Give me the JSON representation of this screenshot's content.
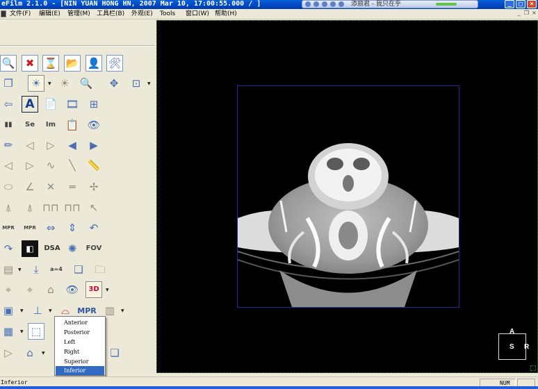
{
  "window": {
    "title": "eFilm 2.1.0 - [NIN YUAN HONG HN, 2007 Mar 10, 17:00:55.000 / ]",
    "media_text": "添丽君 - 我只在乎",
    "controls": {
      "minimize": "_",
      "maximize": "□",
      "close": "×"
    }
  },
  "menubar": {
    "items": [
      "文件(F)",
      "编辑(E)",
      "管理(M)",
      "工具栏(B)",
      "外观(E)",
      "Tools",
      "窗口(W)",
      "帮助(H)"
    ],
    "mdi_controls": {
      "minimize": "_",
      "restore": "❐",
      "close": "×"
    }
  },
  "toolbox": {
    "labels": {
      "dsa": "DSA",
      "fov": "FOV",
      "mpr": "MPR",
      "mpr_small": "MPR",
      "se": "Se",
      "im": "Im",
      "text_tool": "A",
      "dim": "3D"
    }
  },
  "dropdown": {
    "options": [
      "Anterior",
      "Posterior",
      "Left",
      "Right",
      "Superior",
      "Inferior"
    ],
    "selected": "Inferior"
  },
  "viewport": {
    "orientation": {
      "top": "A",
      "left": "S",
      "right": "R"
    }
  },
  "statusbar": {
    "text": "Inferior",
    "num": "NUM"
  },
  "colors": {
    "titlebar": "#0047c2",
    "selection": "#316ac5",
    "viewport_bg": "#000000",
    "frame_border": "#1f2f9a"
  }
}
